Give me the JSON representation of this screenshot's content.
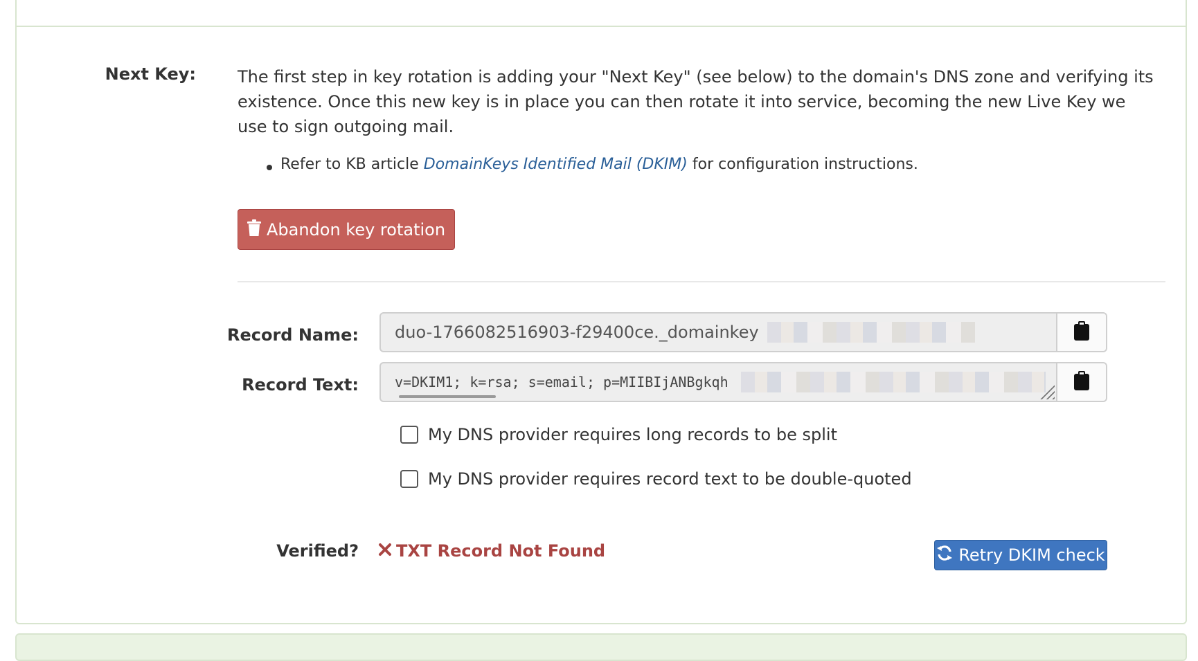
{
  "next_key": {
    "label": "Next Key:",
    "description": "The first step in key rotation is adding your \"Next Key\" (see below) to the domain's DNS zone and verifying its existence. Once this new key is in place you can then rotate it into service, becoming the new Live Key we use to sign outgoing mail.",
    "bullet_prefix": "Refer to KB article",
    "bullet_link": "DomainKeys Identified Mail (DKIM)",
    "bullet_suffix": "for configuration instructions.",
    "abandon_button": "Abandon key rotation"
  },
  "record": {
    "name_label": "Record Name:",
    "name_value": "duo-1766082516903-f29400ce._domainkey",
    "text_label": "Record Text:",
    "text_value": "v=DKIM1; k=rsa; s=email; p=MIIBIjANBgkqh"
  },
  "options": {
    "split_label": "My DNS provider requires long records to be split",
    "split_checked": false,
    "quoted_label": "My DNS provider requires record text to be double-quoted",
    "quoted_checked": false
  },
  "verification": {
    "label": "Verified?",
    "status": "TXT Record Not Found",
    "retry_button": "Retry DKIM check"
  },
  "icons": {
    "abandon": "trash-icon",
    "copy": "clipboard-icon",
    "status": "times-icon",
    "retry": "refresh-icon"
  },
  "colors": {
    "danger": "#c5605a",
    "primary": "#3f76c0",
    "error_text": "#a94442",
    "link": "#2a5f98",
    "panel_border": "#d8e5cf"
  }
}
